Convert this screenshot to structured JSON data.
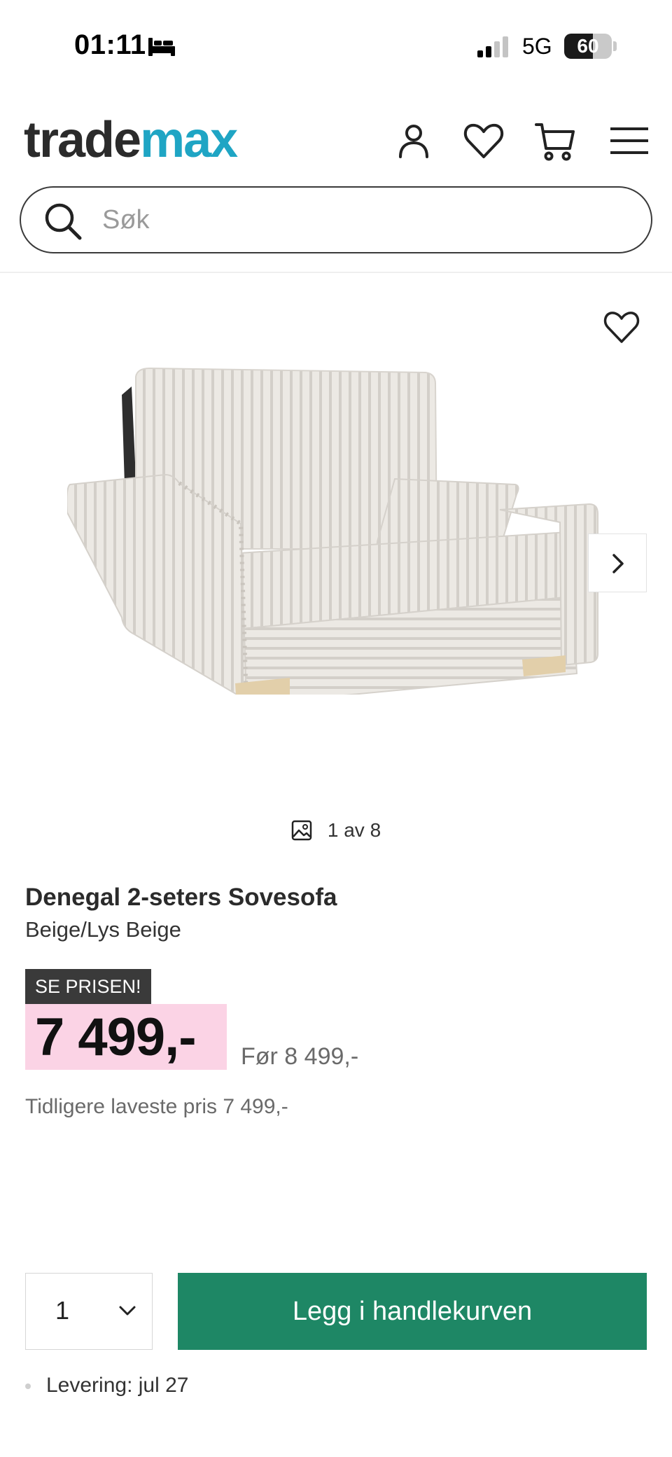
{
  "status_bar": {
    "time": "01:11",
    "network": "5G",
    "battery_level": 60,
    "battery_label": "60"
  },
  "header": {
    "logo_part1": "trade",
    "logo_part2": "max",
    "colors": {
      "logo_dark": "#2b2b2b",
      "logo_accent": "#1fa5c4"
    },
    "icons": [
      "account-icon",
      "heart-icon",
      "cart-icon",
      "menu-icon"
    ]
  },
  "search": {
    "placeholder": "Søk"
  },
  "gallery": {
    "counter": "1 av 8",
    "current": 1,
    "total": 8
  },
  "product": {
    "title": "Denegal 2-seters Sovesofa",
    "variant": "Beige/Lys Beige",
    "badge": "SE PRISEN!",
    "price": "7 499,-",
    "old_price": "Før 8 499,-",
    "lowest_price": "Tidligere laveste pris 7 499,-",
    "colors": {
      "price_bg": "#fbd3e5",
      "badge_bg": "#3a3a3a",
      "cta": "#1e8765"
    }
  },
  "purchase": {
    "quantity": "1",
    "add_to_cart_label": "Legg i handlekurven",
    "delivery": "Levering: jul 27"
  }
}
